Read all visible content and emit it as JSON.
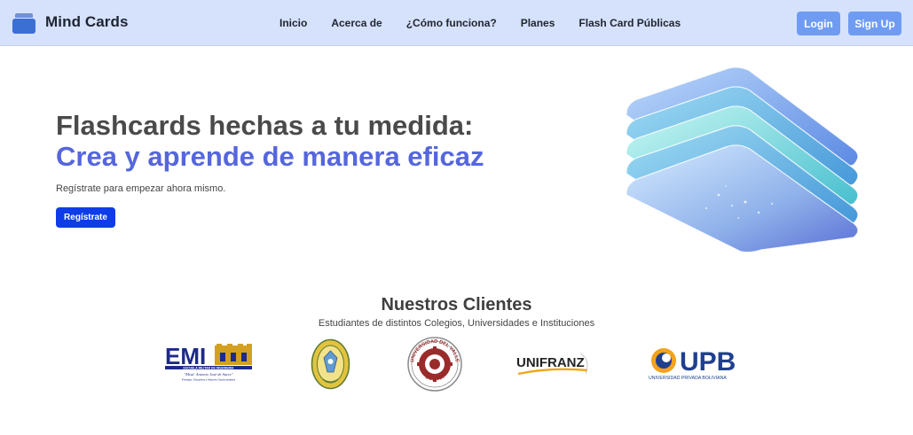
{
  "navbar": {
    "brand": "Mind Cards",
    "links": [
      "Inicio",
      "Acerca de",
      "¿Cómo funciona?",
      "Planes",
      "Flash Card Públicas"
    ],
    "login_label": "Login",
    "signup_label": "Sign Up"
  },
  "hero": {
    "title_line1": "Flashcards hechas a tu medida:",
    "title_line2": "Crea y aprende de manera eficaz",
    "subtitle": "Regístrate para empezar ahora mismo.",
    "cta_label": "Regístrate"
  },
  "clients": {
    "title": "Nuestros Clientes",
    "subtitle": "Estudiantes de distintos Colegios, Universidades e Instituciones",
    "logos": {
      "emi": {
        "name": "EMI",
        "tagline": "ESCUELA MILITAR DE INGENIERIA",
        "motto": "\"Mcal. Antonio José de Sucre\""
      },
      "colegio": {
        "name": "colegio-crest"
      },
      "valle": {
        "top": "UNIVERSIDAD DEL VALLE",
        "bottom": "BOLIVIA"
      },
      "unifranz": {
        "name": "UNIFRANZ"
      },
      "upb": {
        "name": "UPB",
        "tagline": "UNIVERSIDAD PRIVADA BOLIVIANA"
      }
    }
  },
  "colors": {
    "navbar_bg": "#d6e2fb",
    "nav_button": "#6f9cf2",
    "cta_button": "#0d3ce8",
    "accent_title": "#5566dd"
  }
}
